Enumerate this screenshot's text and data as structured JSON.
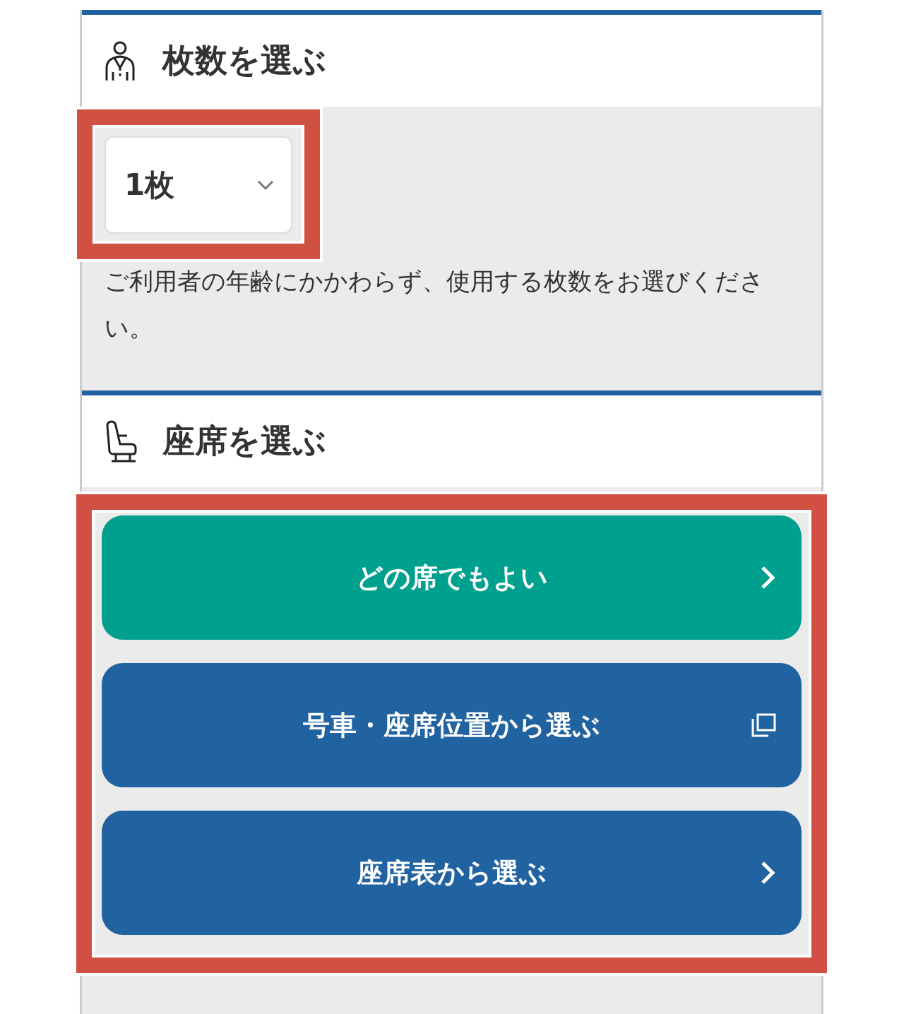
{
  "sections": [
    {
      "kind": "quantity",
      "heading": "枚数を選ぶ",
      "select": {
        "value": "1枚",
        "highlighted": true
      },
      "note": "ご利用者の年齢にかかわらず、使用する枚数をお選びください。"
    },
    {
      "kind": "seat",
      "heading": "座席を選ぶ",
      "highlighted": true,
      "buttons": [
        {
          "label": "どの席でもよい",
          "color": "#00a08e",
          "kind": "next"
        },
        {
          "label": "号車・座席位置から選ぶ",
          "color": "#2162a0",
          "kind": "popup"
        },
        {
          "label": "座席表から選ぶ",
          "color": "#2162a0",
          "kind": "next"
        }
      ]
    }
  ]
}
